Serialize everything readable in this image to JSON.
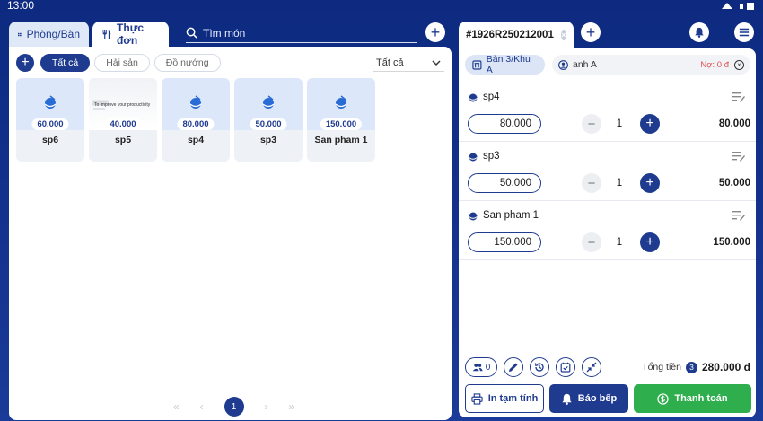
{
  "status_bar": {
    "time": "13:00"
  },
  "left": {
    "tabs": [
      {
        "label": "Phòng/Bàn",
        "icon": "grid-icon",
        "active": false
      },
      {
        "label": "Thực đơn",
        "icon": "fork-knife-icon",
        "active": true
      }
    ],
    "search": {
      "placeholder": "Tìm món"
    },
    "categories": [
      {
        "label": "Tất cả",
        "active": true
      },
      {
        "label": "Hải sản",
        "active": false
      },
      {
        "label": "Đồ nướng",
        "active": false
      }
    ],
    "filter_dropdown": "Tất cả",
    "items": [
      {
        "name": "sp6",
        "price": "60.000",
        "image": "placeholder"
      },
      {
        "name": "sp5",
        "price": "40.000",
        "image": "photo",
        "photo_text": "To improve your productivity"
      },
      {
        "name": "sp4",
        "price": "80.000",
        "image": "placeholder"
      },
      {
        "name": "sp3",
        "price": "50.000",
        "image": "placeholder"
      },
      {
        "name": "San pham 1",
        "price": "150.000",
        "image": "placeholder"
      }
    ],
    "pagination": {
      "current": "1",
      "first": "«",
      "prev": "‹",
      "next": "›",
      "last": "»"
    }
  },
  "right": {
    "order_id": "#1926R250212001",
    "table": "Bàn 3/Khu A",
    "customer": "anh A",
    "debt": "Nợ: 0 đ",
    "lines": [
      {
        "name": "sp4",
        "price": "80.000",
        "qty": "1",
        "total": "80.000"
      },
      {
        "name": "sp3",
        "price": "50.000",
        "qty": "1",
        "total": "50.000"
      },
      {
        "name": "San pham 1",
        "price": "150.000",
        "qty": "1",
        "total": "150.000"
      }
    ],
    "guest_count": "0",
    "total_label": "Tổng tiền",
    "total_count": "3",
    "total_amount": "280.000 đ",
    "buttons": {
      "print": "In tạm tính",
      "kitchen": "Báo bếp",
      "pay": "Thanh toán"
    }
  },
  "colors": {
    "brand": "#1f3b8f",
    "pay": "#2fae4e",
    "debt": "#e05050"
  }
}
